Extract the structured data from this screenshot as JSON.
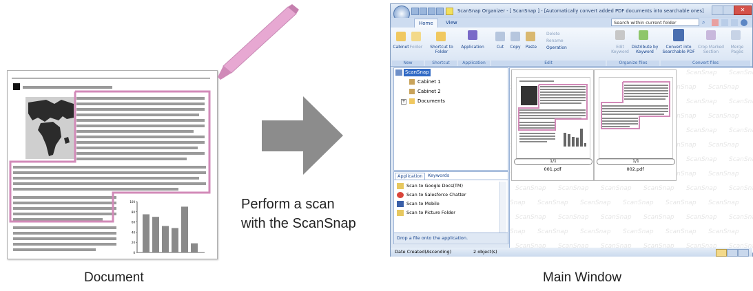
{
  "captions": {
    "document": "Document",
    "main_window": "Main Window",
    "action_line1": "Perform a scan",
    "action_line2": "with the ScanSnap"
  },
  "document": {
    "chart_y_ticks": [
      "100",
      "80",
      "60",
      "40",
      "20",
      "0"
    ],
    "chart_bar_values": [
      75,
      70,
      52,
      48,
      90,
      18
    ]
  },
  "window": {
    "title": "ScanSnap Organizer - [ ScanSnap ] - [Automatically convert added PDF documents into searchable ones]",
    "tabs": [
      "Home",
      "View"
    ],
    "search_label": "Search within current folder",
    "ribbon": {
      "cabinet": "Cabinet",
      "folder": "Folder",
      "shortcut_to_folder": "Shortcut to Folder",
      "application": "Application",
      "cut": "Cut",
      "copy": "Copy",
      "paste": "Paste",
      "delete": "Delete",
      "rename": "Rename",
      "operation": "Operation",
      "edit_keyword": "Edit Keyword",
      "distribute_by_keyword": "Distribute by Keyword",
      "convert_searchable": "Convert into Searchable PDF",
      "crop_marked": "Crop Marked Section",
      "merge_pages": "Merge Pages",
      "groups": [
        "New",
        "Shortcut",
        "Application",
        "Edit",
        "Organize files",
        "Convert files"
      ]
    },
    "tree": {
      "root": "ScanSnap",
      "items": [
        "Cabinet 1",
        "Cabinet 2",
        "Documents"
      ]
    },
    "files": [
      {
        "page": "1/1",
        "name": "001.pdf"
      },
      {
        "page": "1/1",
        "name": "002.pdf"
      }
    ],
    "watermark": "ScanSnap",
    "app_pane": {
      "tabs": [
        "Application",
        "Keywords"
      ],
      "items": [
        "Scan to Google Docs(TM)",
        "Scan to Salesforce Chatter",
        "Scan to Mobile",
        "Scan to Picture Folder"
      ],
      "hint": "Drop a file onto the application."
    },
    "status": {
      "sort": "Date Created(Ascending)",
      "count": "2 object(s)"
    }
  },
  "colors": {
    "highlight_pink": "#d28ab8",
    "arrow_gray": "#8c8c8c",
    "ribbon_blue": "#15428b"
  }
}
